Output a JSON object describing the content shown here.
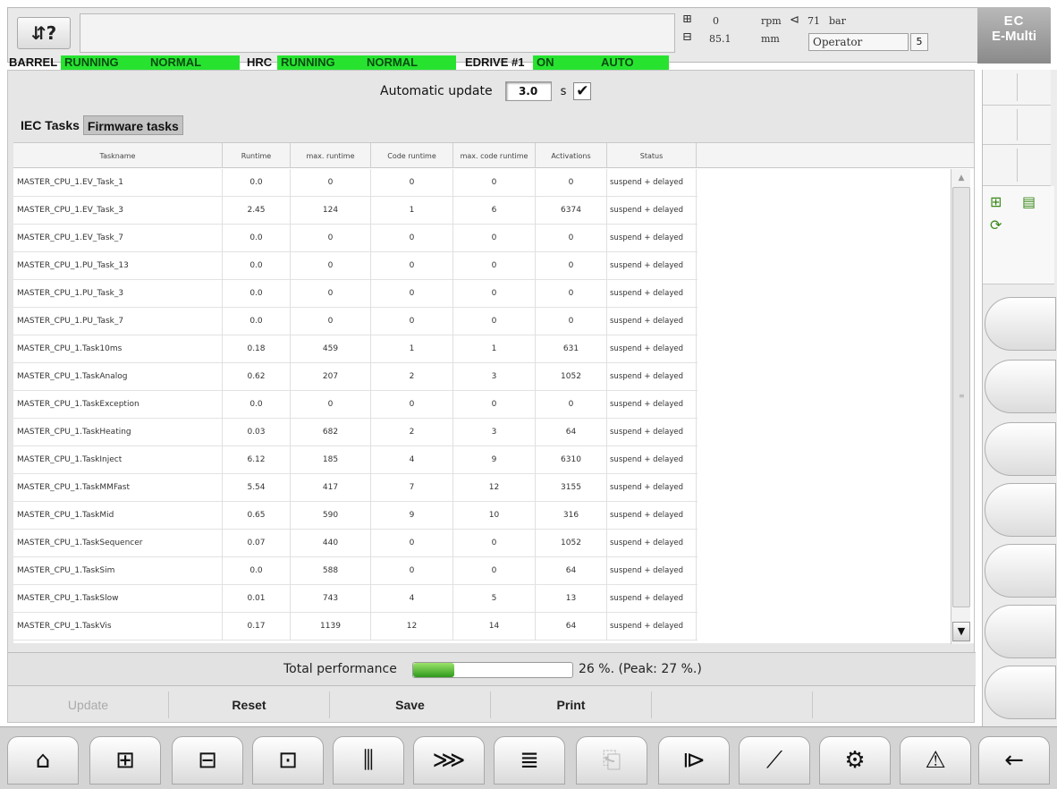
{
  "header": {
    "menu_icon": "menu-help-icon",
    "menu_glyph": "⇵?",
    "message": "",
    "rpm_value": "0",
    "rpm_unit": "rpm",
    "bar_value": "71",
    "bar_unit": "bar",
    "mm_value": "85.1",
    "mm_unit": "mm",
    "operator": "Operator",
    "level": "5",
    "logo_line1": "EC",
    "logo_line2": "E-Multi"
  },
  "status_line": {
    "barrel_label": "BARREL",
    "barrel_state": "RUNNING",
    "barrel_mode": "NORMAL",
    "hrc_label": "HRC",
    "hrc_state": "RUNNING",
    "hrc_mode": "NORMAL",
    "edrive_label": "EDRIVE #1",
    "edrive_state": "ON",
    "edrive_mode": "AUTO",
    "highlight_color": "#27e330"
  },
  "auto_update": {
    "label": "Automatic update",
    "value": "3.0",
    "unit": "s",
    "checked": "✔"
  },
  "tabs": [
    "IEC Tasks",
    "Firmware tasks"
  ],
  "table": {
    "columns": [
      "Taskname",
      "Runtime",
      "max. runtime",
      "Code runtime",
      "max. code runtime",
      "Activations",
      "Status"
    ],
    "rows": [
      [
        "MASTER_CPU_1.EV_Task_1",
        "0.0",
        "0",
        "0",
        "0",
        "0",
        "suspend + delayed"
      ],
      [
        "MASTER_CPU_1.EV_Task_3",
        "2.45",
        "124",
        "1",
        "6",
        "6374",
        "suspend + delayed"
      ],
      [
        "MASTER_CPU_1.EV_Task_7",
        "0.0",
        "0",
        "0",
        "0",
        "0",
        "suspend + delayed"
      ],
      [
        "MASTER_CPU_1.PU_Task_13",
        "0.0",
        "0",
        "0",
        "0",
        "0",
        "suspend + delayed"
      ],
      [
        "MASTER_CPU_1.PU_Task_3",
        "0.0",
        "0",
        "0",
        "0",
        "0",
        "suspend + delayed"
      ],
      [
        "MASTER_CPU_1.PU_Task_7",
        "0.0",
        "0",
        "0",
        "0",
        "0",
        "suspend + delayed"
      ],
      [
        "MASTER_CPU_1.Task10ms",
        "0.18",
        "459",
        "1",
        "1",
        "631",
        "suspend + delayed"
      ],
      [
        "MASTER_CPU_1.TaskAnalog",
        "0.62",
        "207",
        "2",
        "3",
        "1052",
        "suspend + delayed"
      ],
      [
        "MASTER_CPU_1.TaskException",
        "0.0",
        "0",
        "0",
        "0",
        "0",
        "suspend + delayed"
      ],
      [
        "MASTER_CPU_1.TaskHeating",
        "0.03",
        "682",
        "2",
        "3",
        "64",
        "suspend + delayed"
      ],
      [
        "MASTER_CPU_1.TaskInject",
        "6.12",
        "185",
        "4",
        "9",
        "6310",
        "suspend + delayed"
      ],
      [
        "MASTER_CPU_1.TaskMMFast",
        "5.54",
        "417",
        "7",
        "12",
        "3155",
        "suspend + delayed"
      ],
      [
        "MASTER_CPU_1.TaskMid",
        "0.65",
        "590",
        "9",
        "10",
        "316",
        "suspend + delayed"
      ],
      [
        "MASTER_CPU_1.TaskSequencer",
        "0.07",
        "440",
        "0",
        "0",
        "1052",
        "suspend + delayed"
      ],
      [
        "MASTER_CPU_1.TaskSim",
        "0.0",
        "588",
        "0",
        "0",
        "64",
        "suspend + delayed"
      ],
      [
        "MASTER_CPU_1.TaskSlow",
        "0.01",
        "743",
        "4",
        "5",
        "13",
        "suspend + delayed"
      ],
      [
        "MASTER_CPU_1.TaskVis",
        "0.17",
        "1139",
        "12",
        "14",
        "64",
        "suspend + delayed"
      ]
    ]
  },
  "performance": {
    "label": "Total performance",
    "percent": 26,
    "text": "26 %. (Peak: 27 %.)"
  },
  "actions": [
    "Update",
    "Reset",
    "Save",
    "Print"
  ],
  "bottom_nav": [
    {
      "icon": "home-icon",
      "glyph": "⌂",
      "enabled": true
    },
    {
      "icon": "mold-icon",
      "glyph": "⊞",
      "enabled": true
    },
    {
      "icon": "clamp-icon",
      "glyph": "⊟",
      "enabled": true
    },
    {
      "icon": "ejector-icon",
      "glyph": "⊡",
      "enabled": true
    },
    {
      "icon": "heating-icon",
      "glyph": "⫼",
      "enabled": true
    },
    {
      "icon": "injection-icon",
      "glyph": "⋙",
      "enabled": true
    },
    {
      "icon": "list-icon",
      "glyph": "≣",
      "enabled": true
    },
    {
      "icon": "clipboard-icon",
      "glyph": "⎗",
      "enabled": false
    },
    {
      "icon": "nozzle-icon",
      "glyph": "⧐",
      "enabled": true
    },
    {
      "icon": "chart-icon",
      "glyph": "⟋",
      "enabled": true
    },
    {
      "icon": "settings-icon",
      "glyph": "⚙",
      "enabled": true
    },
    {
      "icon": "alarm-icon",
      "glyph": "⚠",
      "enabled": true
    },
    {
      "icon": "back-arrow-icon",
      "glyph": "←",
      "enabled": true
    }
  ]
}
